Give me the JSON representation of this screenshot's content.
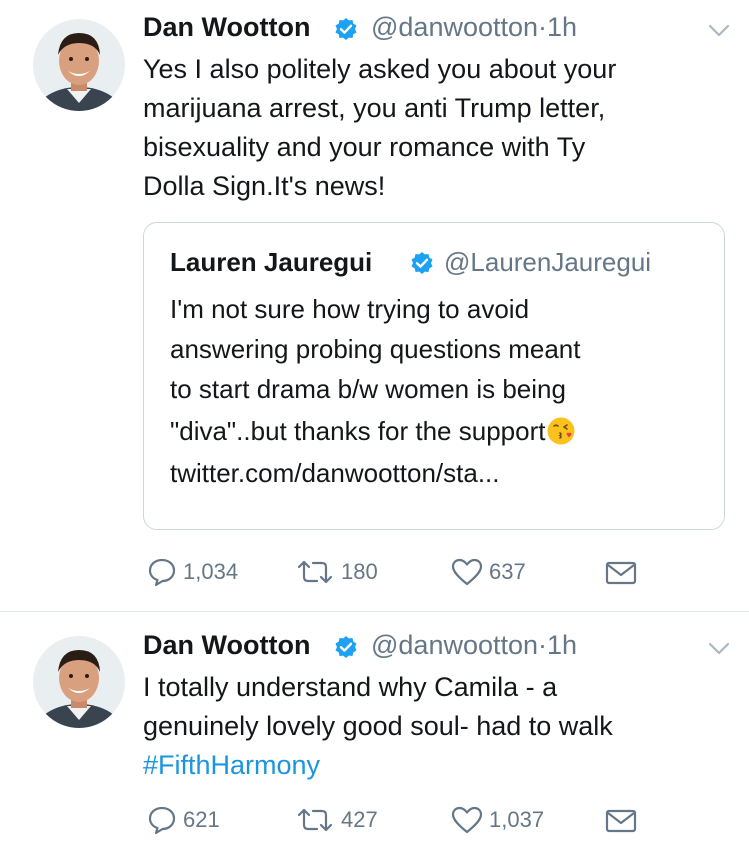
{
  "tweets": [
    {
      "author_name": "Dan Wootton",
      "handle": "@danwootton",
      "separator": "·",
      "time": "1h",
      "text_lines": [
        "Yes I also politely asked you about your",
        "marijuana arrest, you anti Trump letter,",
        "bisexuality and your romance with Ty",
        "Dolla Sign.It's news!"
      ],
      "quote": {
        "author_name": "Lauren Jauregui",
        "handle": "@LaurenJauregui",
        "text_lines": [
          "I'm not sure how trying to avoid",
          "answering probing questions meant",
          "to start drama b/w women is being",
          "\"diva\"..but thanks for the support",
          "twitter.com/danwootton/sta..."
        ]
      },
      "actions": {
        "replies": "1,034",
        "retweets": "180",
        "likes": "637"
      }
    },
    {
      "author_name": "Dan Wootton",
      "handle": "@danwootton",
      "separator": "·",
      "time": "1h",
      "text_lines": [
        "I totally understand why Camila - a",
        "genuinely lovely good soul- had to walk"
      ],
      "hashtag": "#FifthHarmony",
      "actions": {
        "replies": "621",
        "retweets": "427",
        "likes": "1,037"
      }
    }
  ],
  "colors": {
    "link": "#1b95e0",
    "verified": "#1da1f2",
    "muted": "#657786",
    "border": "#ccd6dd"
  },
  "icons": [
    "avatar",
    "verified-badge-icon",
    "chevron-down-icon",
    "reply-icon",
    "retweet-icon",
    "heart-icon",
    "mail-icon",
    "kissing-face-emoji"
  ]
}
